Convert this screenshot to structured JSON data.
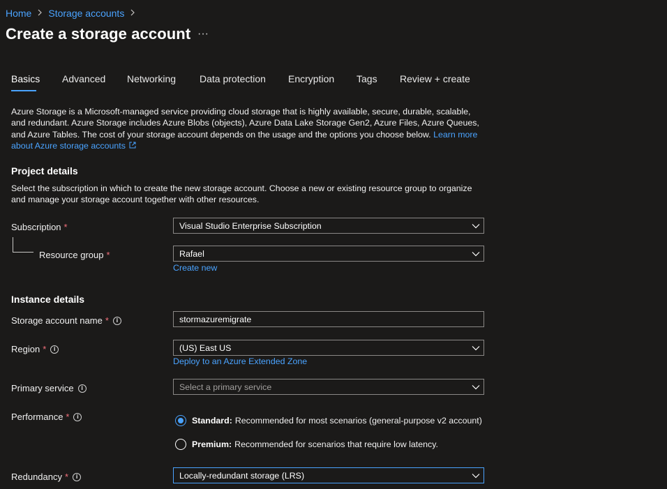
{
  "breadcrumb": {
    "home": "Home",
    "storage_accounts": "Storage accounts",
    "sep": ">"
  },
  "page": {
    "title": "Create a storage account",
    "more": "···"
  },
  "tabs": [
    {
      "label": "Basics",
      "active": true
    },
    {
      "label": "Advanced"
    },
    {
      "label": "Networking"
    },
    {
      "label": "Data protection"
    },
    {
      "label": "Encryption"
    },
    {
      "label": "Tags"
    },
    {
      "label": "Review + create"
    }
  ],
  "intro": {
    "text": "Azure Storage is a Microsoft-managed service providing cloud storage that is highly available, secure, durable, scalable, and redundant. Azure Storage includes Azure Blobs (objects), Azure Data Lake Storage Gen2, Azure Files, Azure Queues, and Azure Tables. The cost of your storage account depends on the usage and the options you choose below.",
    "link": "Learn more about Azure storage accounts"
  },
  "project": {
    "heading": "Project details",
    "desc": "Select the subscription in which to create the new storage account. Choose a new or existing resource group to organize and manage your storage account together with other resources.",
    "subscription_label": "Subscription",
    "subscription_value": "Visual Studio Enterprise Subscription",
    "resource_group_label": "Resource group",
    "resource_group_value": "Rafael",
    "create_new": "Create new"
  },
  "instance": {
    "heading": "Instance details",
    "name_label": "Storage account name",
    "name_value": "stormazuremigrate",
    "region_label": "Region",
    "region_value": "(US) East US",
    "extended_zone_link": "Deploy to an Azure Extended Zone",
    "primary_label": "Primary service",
    "primary_placeholder": "Select a primary service",
    "performance_label": "Performance",
    "standard_title": "Standard:",
    "standard_desc": "Recommended for most scenarios (general-purpose v2 account)",
    "premium_title": "Premium:",
    "premium_desc": "Recommended for scenarios that require low latency.",
    "performance_selected": "Standard",
    "redundancy_label": "Redundancy",
    "redundancy_value": "Locally-redundant storage (LRS)"
  },
  "required_marker": "*",
  "info_glyph": "i",
  "colors": {
    "accent": "#4aa3ff",
    "background": "#1b1a19",
    "required": "#f1707b"
  },
  "icons": [
    "chevron-right-icon",
    "chevron-down-icon",
    "info-icon",
    "external-link-icon",
    "more-icon"
  ]
}
